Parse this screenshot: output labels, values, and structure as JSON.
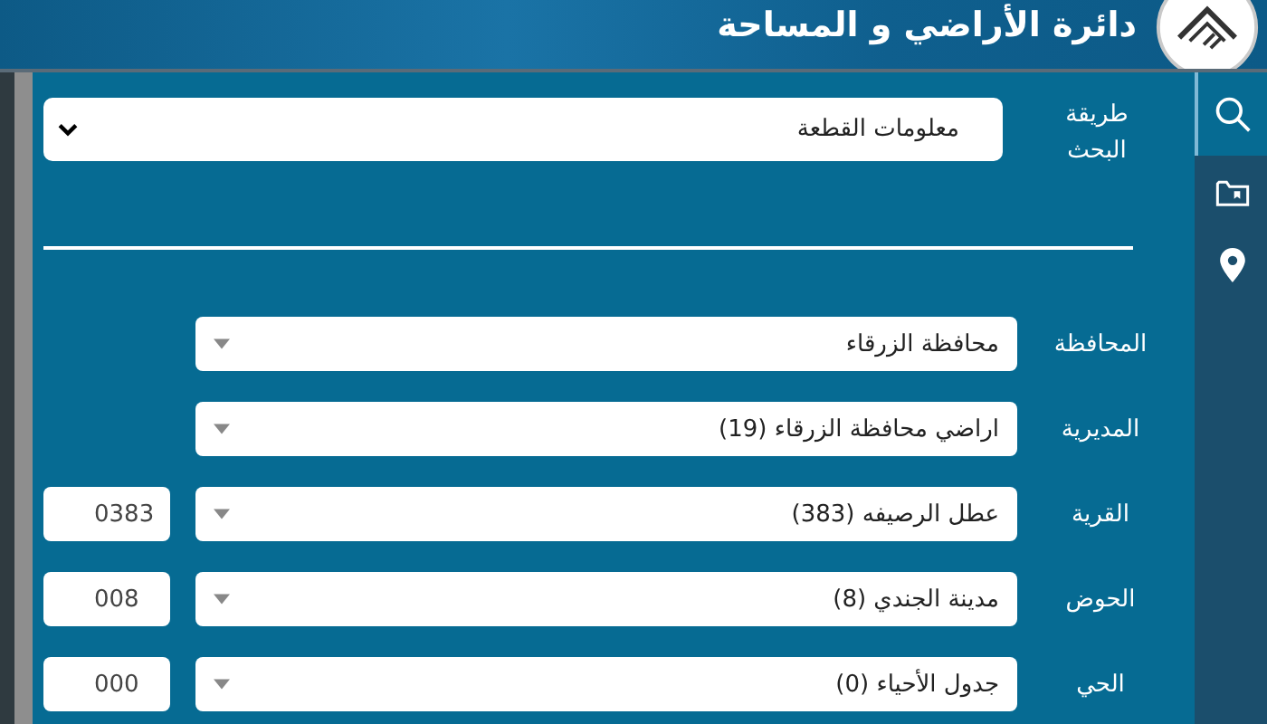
{
  "header": {
    "title": "دائرة الأراضي و المساحة"
  },
  "sidebar": {
    "items": [
      {
        "selected": true
      },
      {
        "selected": false
      },
      {
        "selected": false
      }
    ]
  },
  "search_method": {
    "label": "طريقة البحث",
    "value": "معلومات القطعة"
  },
  "fields": [
    {
      "label": "المحافظة",
      "value": "محافظة الزرقاء"
    },
    {
      "label": "المديرية",
      "value": "اراضي محافظة الزرقاء (19)"
    },
    {
      "label": "القرية",
      "value": "عطل الرصيفه (383)",
      "code": "0383"
    },
    {
      "label": "الحوض",
      "value": "مدينة الجندي (8)",
      "code": "008"
    },
    {
      "label": "الحي",
      "value": "جدول الأحياء (0)",
      "code": "000"
    }
  ]
}
